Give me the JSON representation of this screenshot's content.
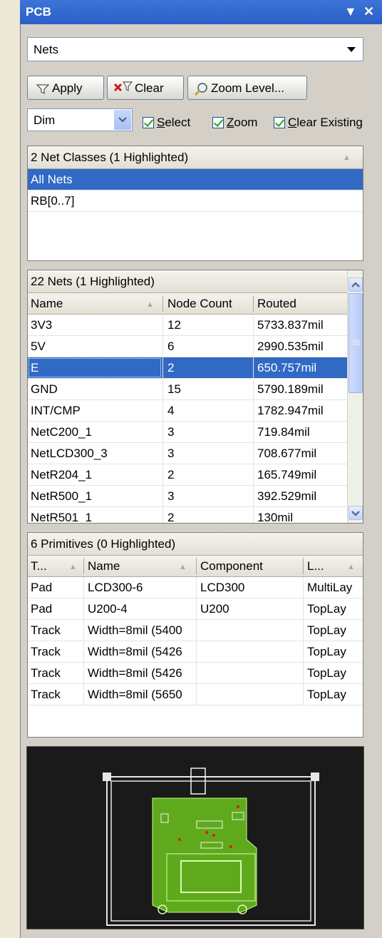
{
  "window": {
    "title": "PCB",
    "menu_glyph": "▼",
    "close_glyph": "✕"
  },
  "mode_select": {
    "value": "Nets"
  },
  "toolbar": {
    "apply_label": "Apply",
    "clear_label": "Clear",
    "zoom_label": "Zoom Level..."
  },
  "filter": {
    "mask_mode": "Dim",
    "select": {
      "label": "Select",
      "checked": true
    },
    "zoom": {
      "label": "Zoom",
      "checked": true
    },
    "clear_existing": {
      "label": "Clear Existing",
      "checked": true
    }
  },
  "net_classes": {
    "header": "2 Net Classes (1 Highlighted)",
    "items": [
      {
        "label": "All Nets",
        "selected": true
      },
      {
        "label": "RB[0..7]",
        "selected": false
      }
    ]
  },
  "nets": {
    "header": "22 Nets (1 Highlighted)",
    "columns": [
      "Name",
      "Node Count",
      "Routed"
    ],
    "rows": [
      {
        "name": "3V3",
        "nodes": "12",
        "routed": "5733.837mil"
      },
      {
        "name": "5V",
        "nodes": "6",
        "routed": "2990.535mil"
      },
      {
        "name": "E",
        "nodes": "2",
        "routed": "650.757mil",
        "selected": true
      },
      {
        "name": "GND",
        "nodes": "15",
        "routed": "5790.189mil"
      },
      {
        "name": "INT/CMP",
        "nodes": "4",
        "routed": "1782.947mil"
      },
      {
        "name": "NetC200_1",
        "nodes": "3",
        "routed": "719.84mil"
      },
      {
        "name": "NetLCD300_3",
        "nodes": "3",
        "routed": "708.677mil"
      },
      {
        "name": "NetR204_1",
        "nodes": "2",
        "routed": "165.749mil"
      },
      {
        "name": "NetR500_1",
        "nodes": "3",
        "routed": "392.529mil"
      },
      {
        "name": "NetR501_1",
        "nodes": "2",
        "routed": "130mil"
      }
    ]
  },
  "primitives": {
    "header": "6 Primitives (0 Highlighted)",
    "columns": [
      "T...",
      "Name",
      "Component",
      "L..."
    ],
    "rows": [
      {
        "type": "Pad",
        "name": "LCD300-6",
        "component": "LCD300",
        "layer": "MultiLay"
      },
      {
        "type": "Pad",
        "name": "U200-4",
        "component": "U200",
        "layer": "TopLay"
      },
      {
        "type": "Track",
        "name": "Width=8mil (5400",
        "component": "",
        "layer": "TopLay"
      },
      {
        "type": "Track",
        "name": "Width=8mil (5426",
        "component": "",
        "layer": "TopLay"
      },
      {
        "type": "Track",
        "name": "Width=8mil (5426",
        "component": "",
        "layer": "TopLay"
      },
      {
        "type": "Track",
        "name": "Width=8mil (5650",
        "component": "",
        "layer": "TopLay"
      }
    ]
  }
}
